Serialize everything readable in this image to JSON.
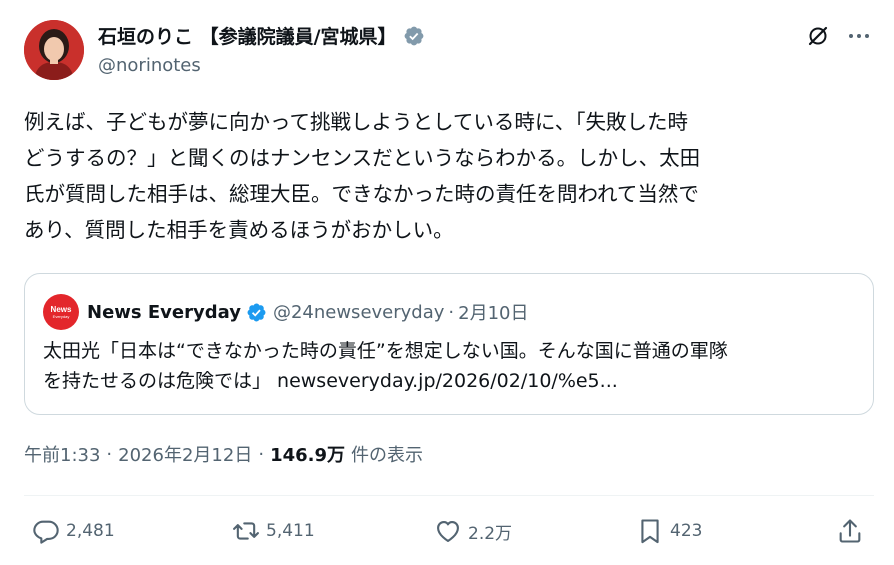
{
  "author": {
    "display_name": "石垣のりこ 【参議院議員/宮城県】",
    "handle": "@norinotes"
  },
  "tweet": {
    "lines": [
      "例えば、子どもが夢に向かって挑戦しようとしている時に、「失敗した時",
      "どうするの？」と聞くのはナンセンスだというならわかる。しかし、太田",
      "氏が質問した相手は、総理大臣。できなかった時の責任を問われて当然で",
      "あり、質問した相手を責めるほうがおかしい。"
    ]
  },
  "quote": {
    "avatar_text": "News",
    "avatar_subtext": "Everyday",
    "name": "News Everyday",
    "handle": "@24newseveryday",
    "separator": "·",
    "date": "2月10日",
    "lines": [
      "太田光「日本は“できなかった時の責任”を想定しない国。そんな国に普通の軍隊",
      "を持たせるのは危険では」 newseveryday.jp/2026/02/10/%e5..."
    ]
  },
  "meta": {
    "time": "午前1:33",
    "separator": "·",
    "date": "2026年2月12日",
    "views": "146.9万",
    "views_label": "件の表示"
  },
  "actions": {
    "reply_count": "2,481",
    "retweet_count": "5,411",
    "like_count": "2.2万",
    "bookmark_count": "423"
  },
  "icons": {
    "verified": "verified-badge-icon",
    "grok": "grok-icon",
    "more": "more-icon",
    "reply": "reply-icon",
    "retweet": "retweet-icon",
    "like": "heart-icon",
    "bookmark": "bookmark-icon",
    "share": "share-icon"
  },
  "colors": {
    "text": "#0f1419",
    "secondary": "#536471",
    "verified_gray": "#829aab",
    "verified_blue": "#1d9bf0",
    "news_red": "#e3262b",
    "border": "#cfd9de"
  }
}
